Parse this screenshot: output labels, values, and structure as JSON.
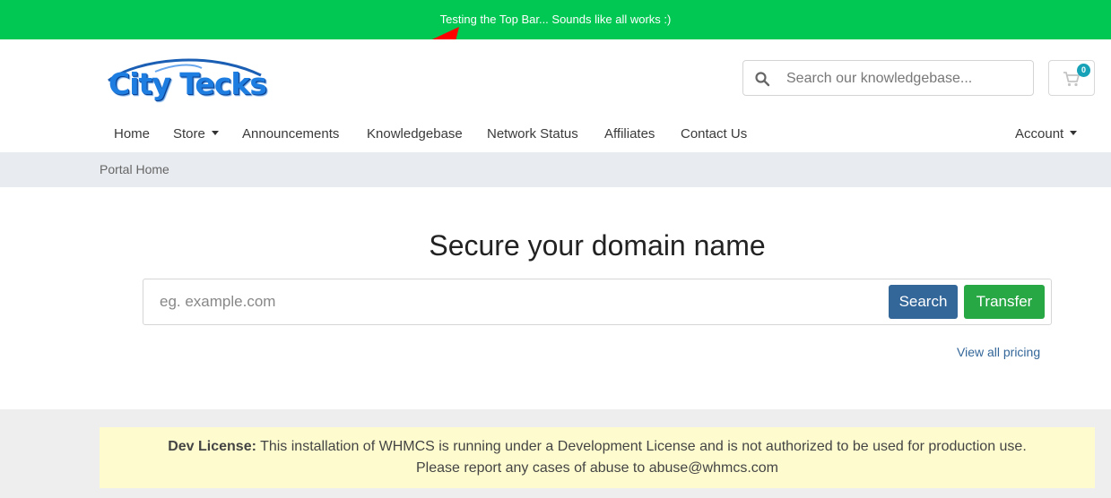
{
  "topbar": {
    "message": "Testing the Top Bar... Sounds like all works :)"
  },
  "brand": {
    "logo_text": "City Tecks"
  },
  "kb_search": {
    "placeholder": "Search our knowledgebase..."
  },
  "cart": {
    "count": "0"
  },
  "nav": {
    "home": "Home",
    "store": "Store",
    "announcements": "Announcements",
    "knowledgebase": "Knowledgebase",
    "network_status": "Network Status",
    "affiliates": "Affiliates",
    "contact": "Contact Us",
    "account": "Account"
  },
  "breadcrumb": {
    "home": "Portal Home"
  },
  "domain": {
    "title": "Secure your domain name",
    "placeholder": "eg. example.com",
    "search_label": "Search",
    "transfer_label": "Transfer",
    "pricing_link": "View all pricing"
  },
  "notice": {
    "label": "Dev License:",
    "line1": "This installation of WHMCS is running under a Development License and is not authorized to be used for production use.",
    "line2": "Please report any cases of abuse to abuse@whmcs.com"
  },
  "colors": {
    "topbar": "#00c853",
    "primary": "#336699",
    "success": "#28a745",
    "arrow": "#ff0000",
    "badge": "#17a2b8"
  }
}
